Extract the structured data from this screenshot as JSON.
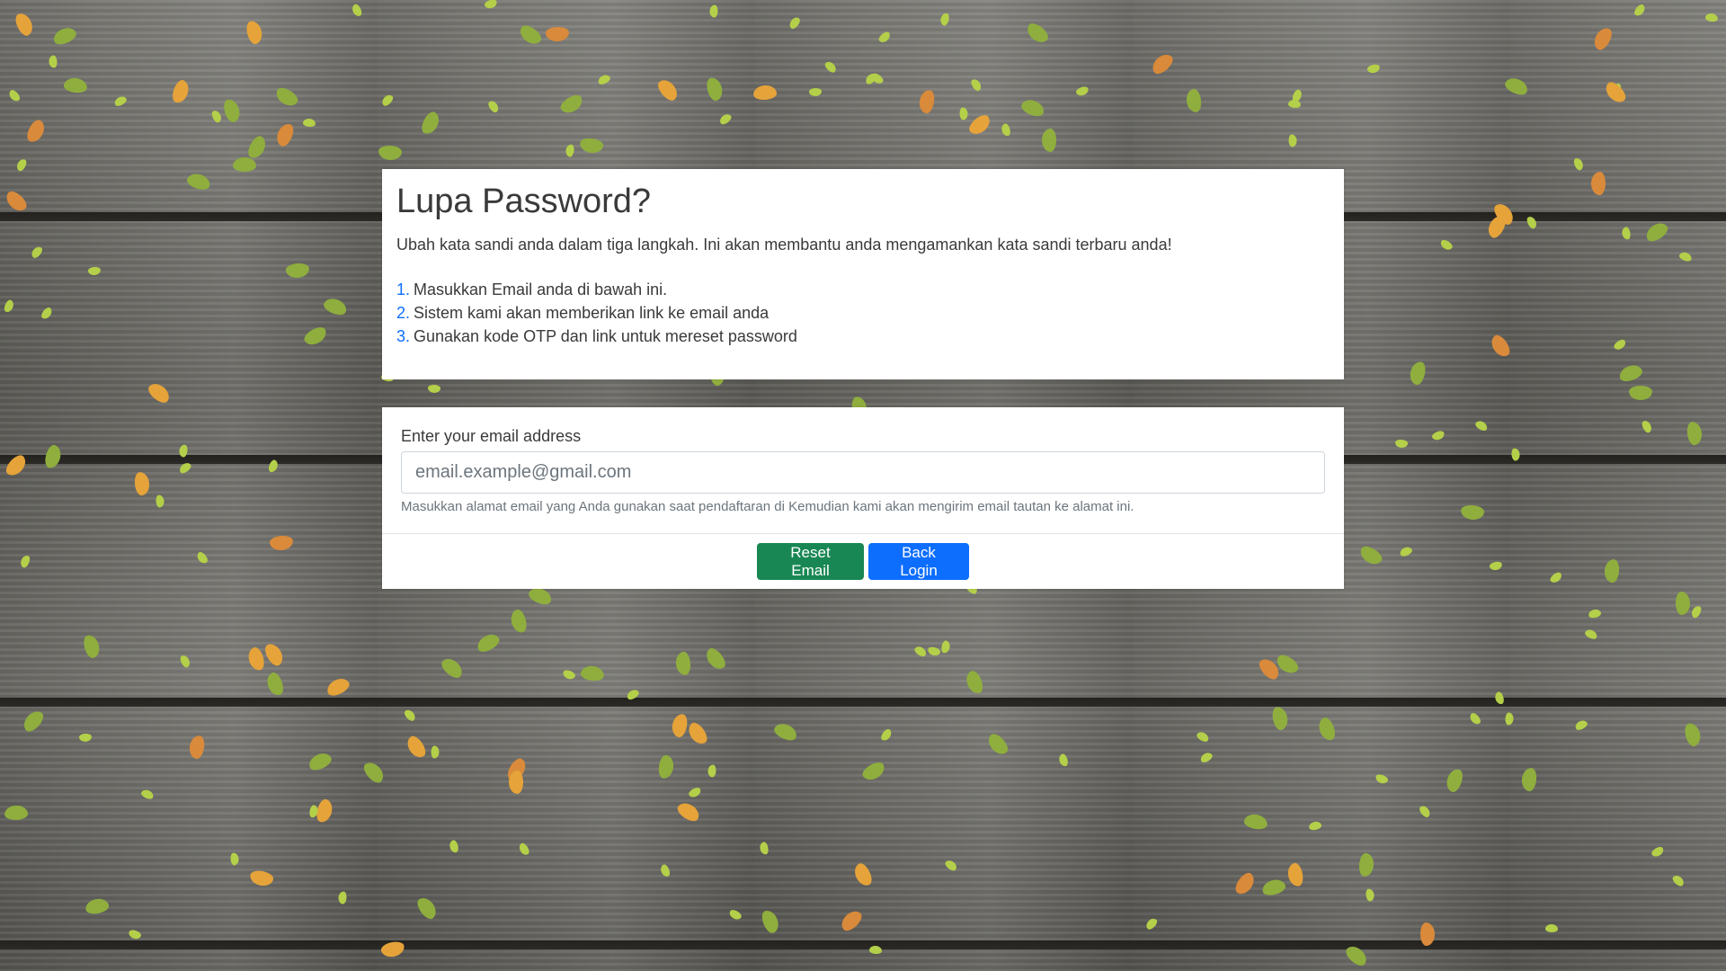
{
  "info_card": {
    "title": "Lupa Password?",
    "intro": "Ubah kata sandi anda dalam tiga langkah. Ini akan membantu anda mengamankan kata sandi terbaru anda!",
    "steps": [
      {
        "num": "1.",
        "text": "Masukkan Email anda di bawah ini."
      },
      {
        "num": "2.",
        "text": "Sistem kami akan memberikan link ke email anda"
      },
      {
        "num": "3.",
        "text": "Gunakan kode OTP dan link untuk mereset password"
      }
    ]
  },
  "form": {
    "email_label": "Enter your email address",
    "email_placeholder": "email.example@gmail.com",
    "email_value": "",
    "help_text": "Masukkan alamat email yang Anda gunakan saat pendaftaran di Kemudian kami akan mengirim email tautan ke alamat ini.",
    "reset_button": "Reset Email",
    "back_button": "Back Login"
  },
  "colors": {
    "success": "#198754",
    "primary": "#0d6efd",
    "step_number": "#0d6efd"
  }
}
